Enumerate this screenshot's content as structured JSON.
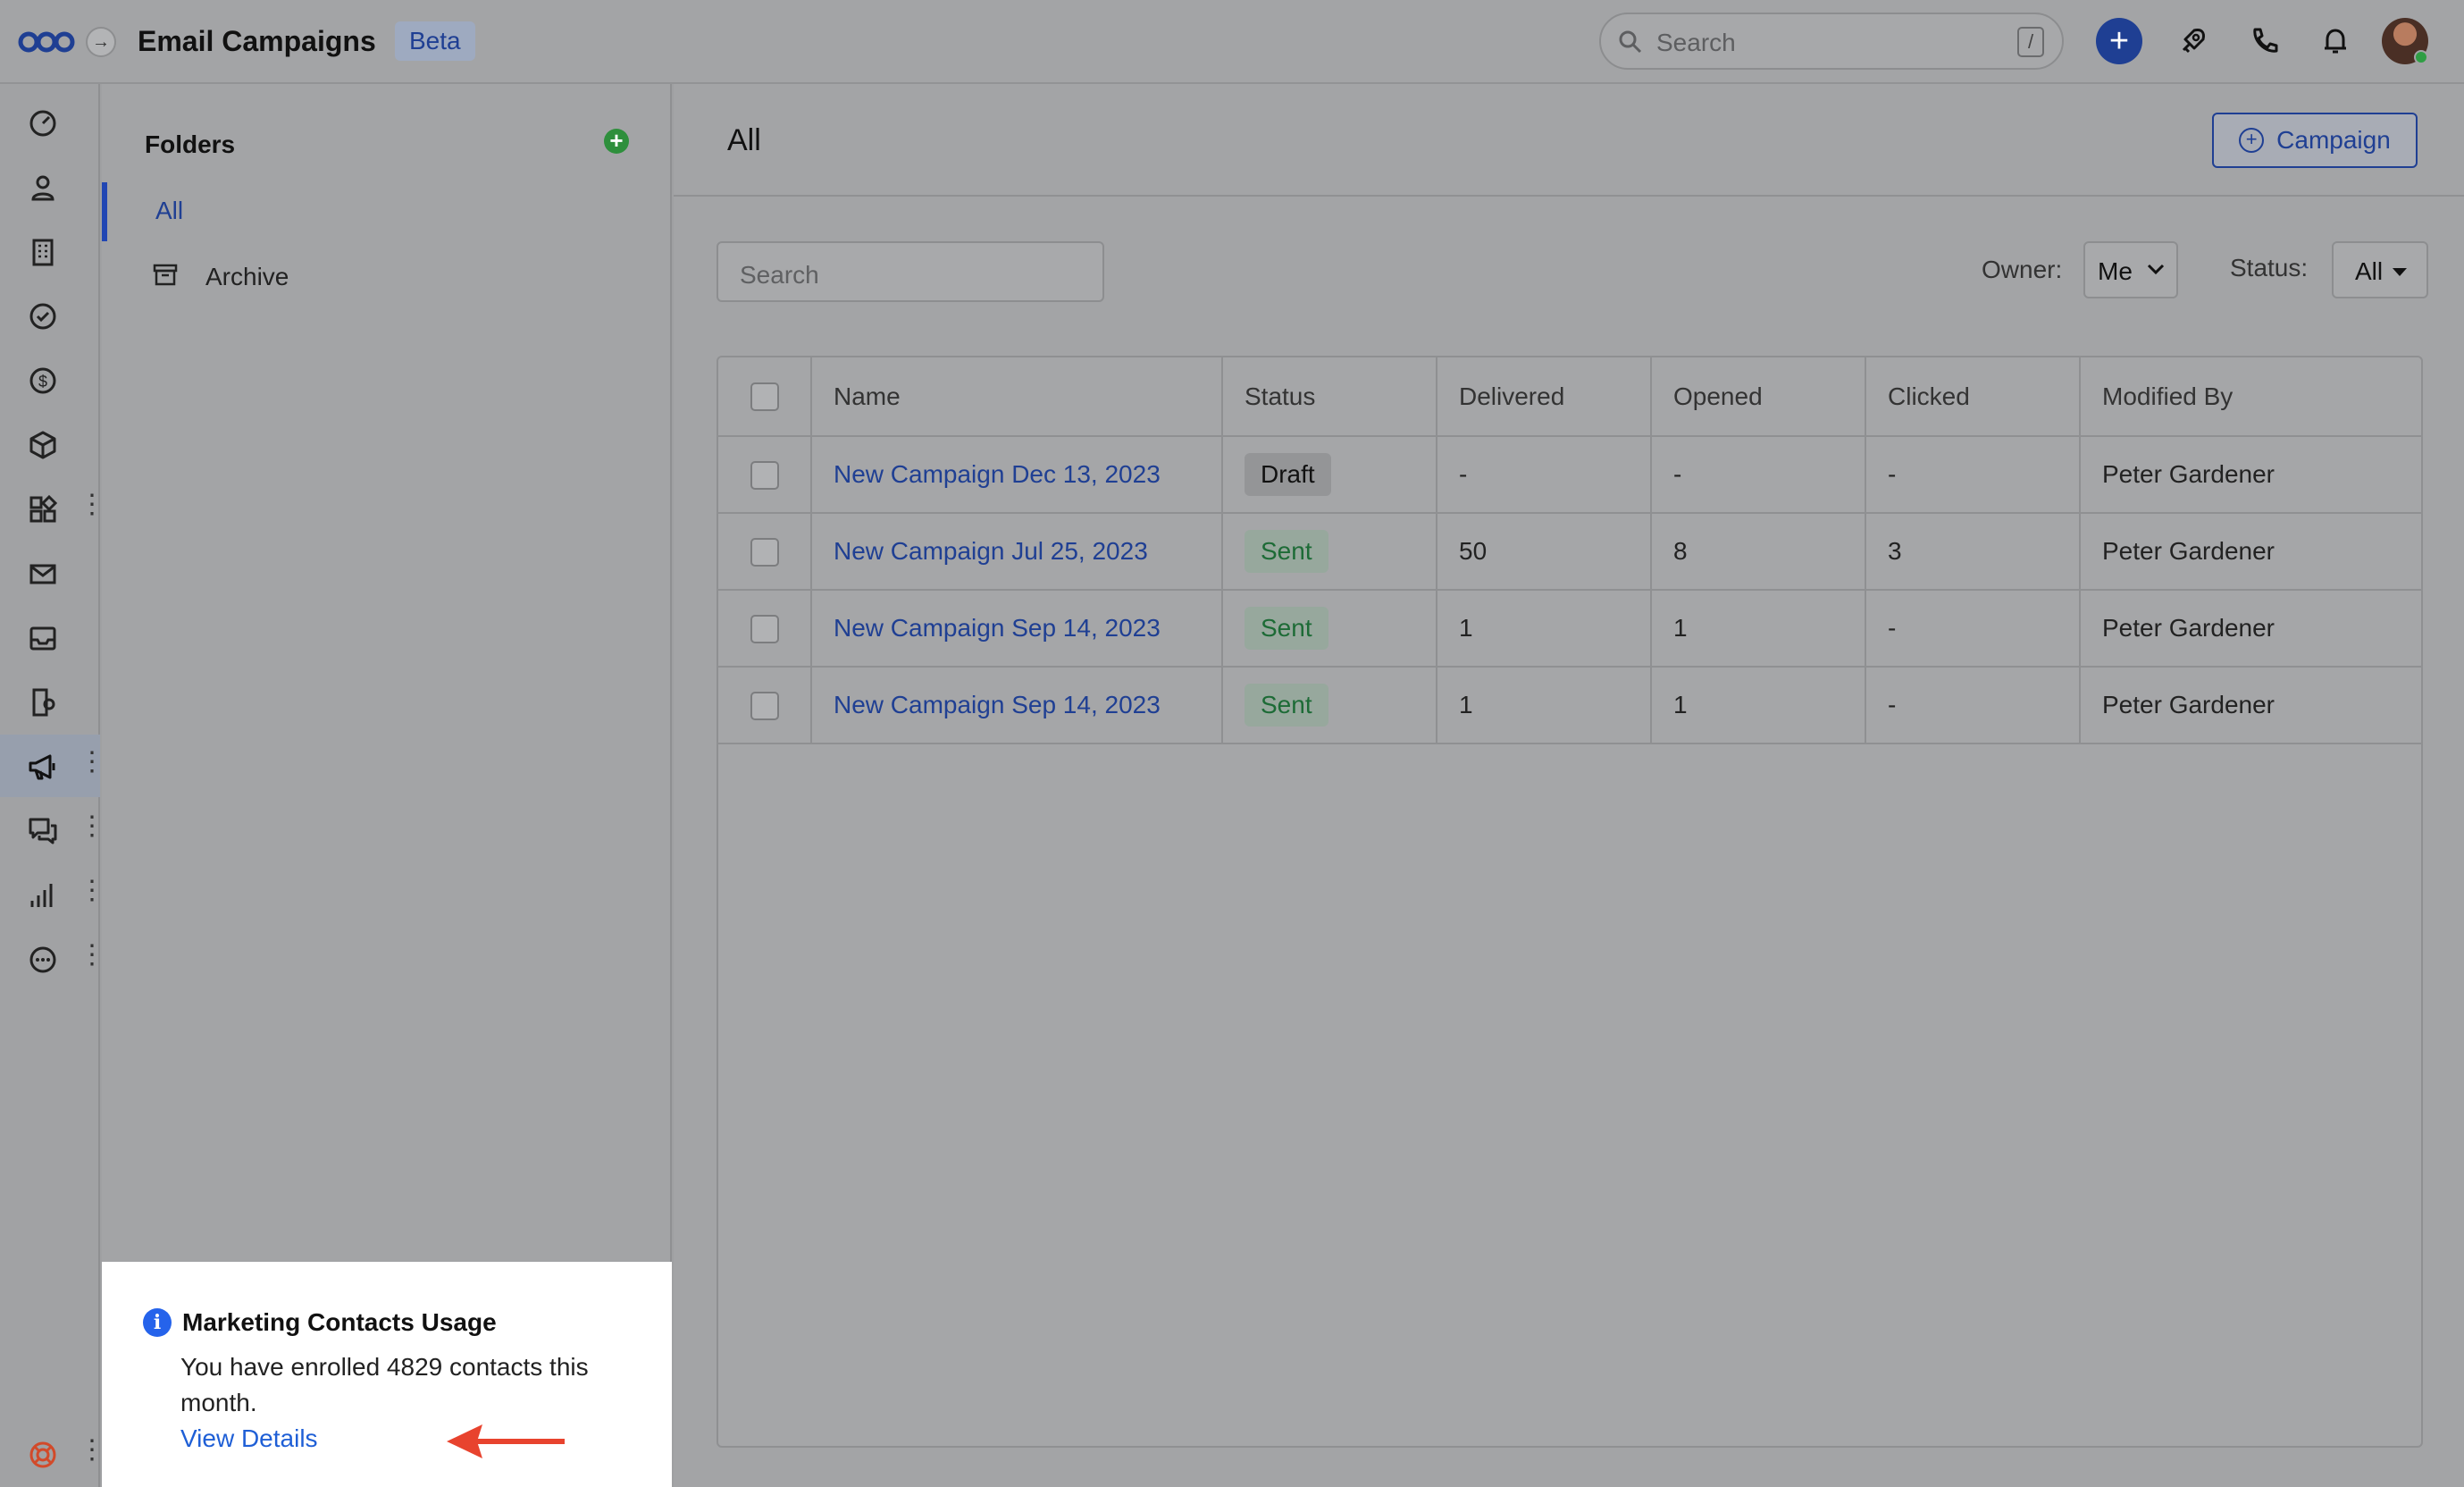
{
  "header": {
    "title": "Email Campaigns",
    "badge": "Beta",
    "search_placeholder": "Search",
    "search_shortcut": "/"
  },
  "rail": {
    "items": [
      {
        "name": "dashboard-icon"
      },
      {
        "name": "contacts-icon"
      },
      {
        "name": "companies-icon"
      },
      {
        "name": "tasks-icon"
      },
      {
        "name": "deals-icon"
      },
      {
        "name": "products-icon"
      },
      {
        "name": "apps-icon",
        "menu": true
      },
      {
        "name": "mail-icon"
      },
      {
        "name": "inbox-icon"
      },
      {
        "name": "documents-icon"
      },
      {
        "name": "campaigns-icon",
        "menu": true,
        "active": true
      },
      {
        "name": "conversations-icon",
        "menu": true
      },
      {
        "name": "reports-icon",
        "menu": true
      },
      {
        "name": "more-icon",
        "menu": true
      }
    ],
    "help_icon": "lifebuoy-icon"
  },
  "folders": {
    "title": "Folders",
    "items": [
      {
        "label": "All",
        "selected": true
      },
      {
        "label": "Archive",
        "icon": "archive-icon"
      }
    ]
  },
  "notice": {
    "title": "Marketing Contacts Usage",
    "body": "You have enrolled 4829 contacts this month.",
    "link": "View Details"
  },
  "main": {
    "title": "All",
    "new_button": "Campaign",
    "search_placeholder": "Search",
    "owner_label": "Owner:",
    "owner_value": "Me",
    "status_label": "Status:",
    "status_value": "All"
  },
  "table": {
    "columns": [
      "Name",
      "Status",
      "Delivered",
      "Opened",
      "Clicked",
      "Modified By"
    ],
    "rows": [
      {
        "name": "New Campaign Dec 13, 2023",
        "status": "Draft",
        "delivered": "-",
        "opened": "-",
        "clicked": "-",
        "modified_by": "Peter Gardener"
      },
      {
        "name": "New Campaign Jul 25, 2023",
        "status": "Sent",
        "delivered": "50",
        "opened": "8",
        "clicked": "3",
        "modified_by": "Peter Gardener"
      },
      {
        "name": "New Campaign Sep 14, 2023",
        "status": "Sent",
        "delivered": "1",
        "opened": "1",
        "clicked": "-",
        "modified_by": "Peter Gardener"
      },
      {
        "name": "New Campaign Sep 14, 2023",
        "status": "Sent",
        "delivered": "1",
        "opened": "1",
        "clicked": "-",
        "modified_by": "Peter Gardener"
      }
    ]
  },
  "colors": {
    "accent": "#1f3f93",
    "link": "#1f5fd6",
    "success": "#2e8f3c",
    "annotation_arrow": "#e8432e"
  }
}
